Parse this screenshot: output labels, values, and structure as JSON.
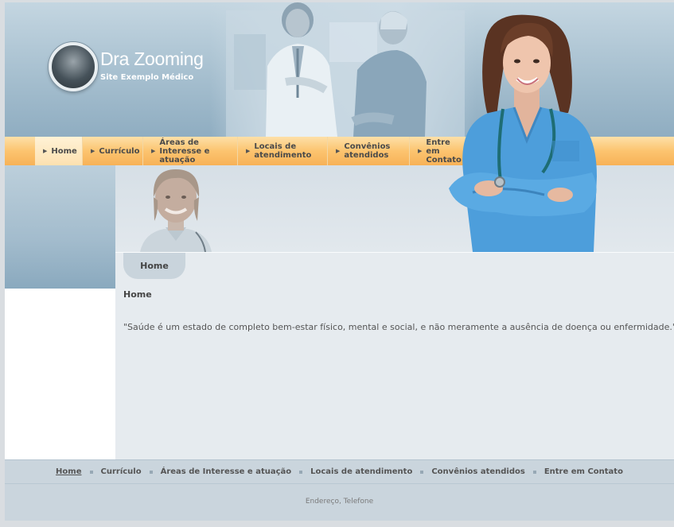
{
  "header": {
    "title": "Dra Zooming",
    "subtitle": "Site Exemplo Médico"
  },
  "nav": {
    "items": [
      {
        "label": "Home",
        "active": true
      },
      {
        "label": "Currículo"
      },
      {
        "label": "Áreas de Interesse e atuação"
      },
      {
        "label": "Locais de atendimento"
      },
      {
        "label": "Convênios atendidos"
      },
      {
        "label": "Entre em Contato"
      }
    ]
  },
  "page": {
    "tab_label": "Home",
    "heading": "Home",
    "quote": "\"Saúde é um estado de completo bem-estar físico, mental e social, e não meramente a ausência de doença ou enfermidade.\""
  },
  "footer": {
    "links": [
      "Home",
      "Currículo",
      "Áreas de Interesse e atuação",
      "Locais de atendimento",
      "Convênios atendidos",
      "Entre em Contato"
    ],
    "address": "Endereço, Telefone"
  },
  "colors": {
    "nav_orange": "#fcc46f",
    "header_blue": "#a6bfcf",
    "scrubs_blue": "#4a9fd9"
  }
}
